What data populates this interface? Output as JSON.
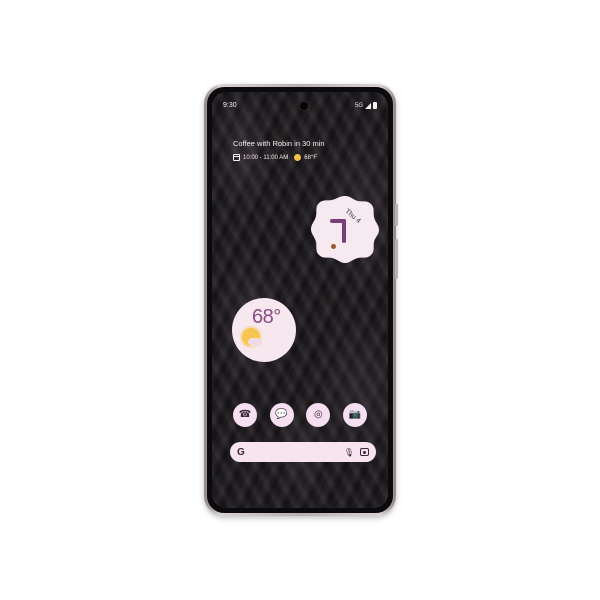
{
  "status_bar": {
    "time": "9:30",
    "network": "5G"
  },
  "at_a_glance": {
    "title": "Coffee with Robin in 30 min",
    "event_time": "10:00 - 11:00 AM",
    "weather": "68°F"
  },
  "clock_widget": {
    "date": "Thu 4"
  },
  "weather_widget": {
    "temperature": "68°"
  },
  "dock": {
    "apps": [
      {
        "name": "phone",
        "icon": "☎"
      },
      {
        "name": "messages",
        "icon": "💬"
      },
      {
        "name": "chrome",
        "icon": "◎"
      },
      {
        "name": "camera",
        "icon": "📷"
      }
    ]
  },
  "search_bar": {
    "logo": "G",
    "mic_icon": "🎙"
  },
  "colors": {
    "widget_bg": "#f7e7ee",
    "accent_purple": "#8a4b84",
    "sun_yellow": "#f6c64e"
  }
}
